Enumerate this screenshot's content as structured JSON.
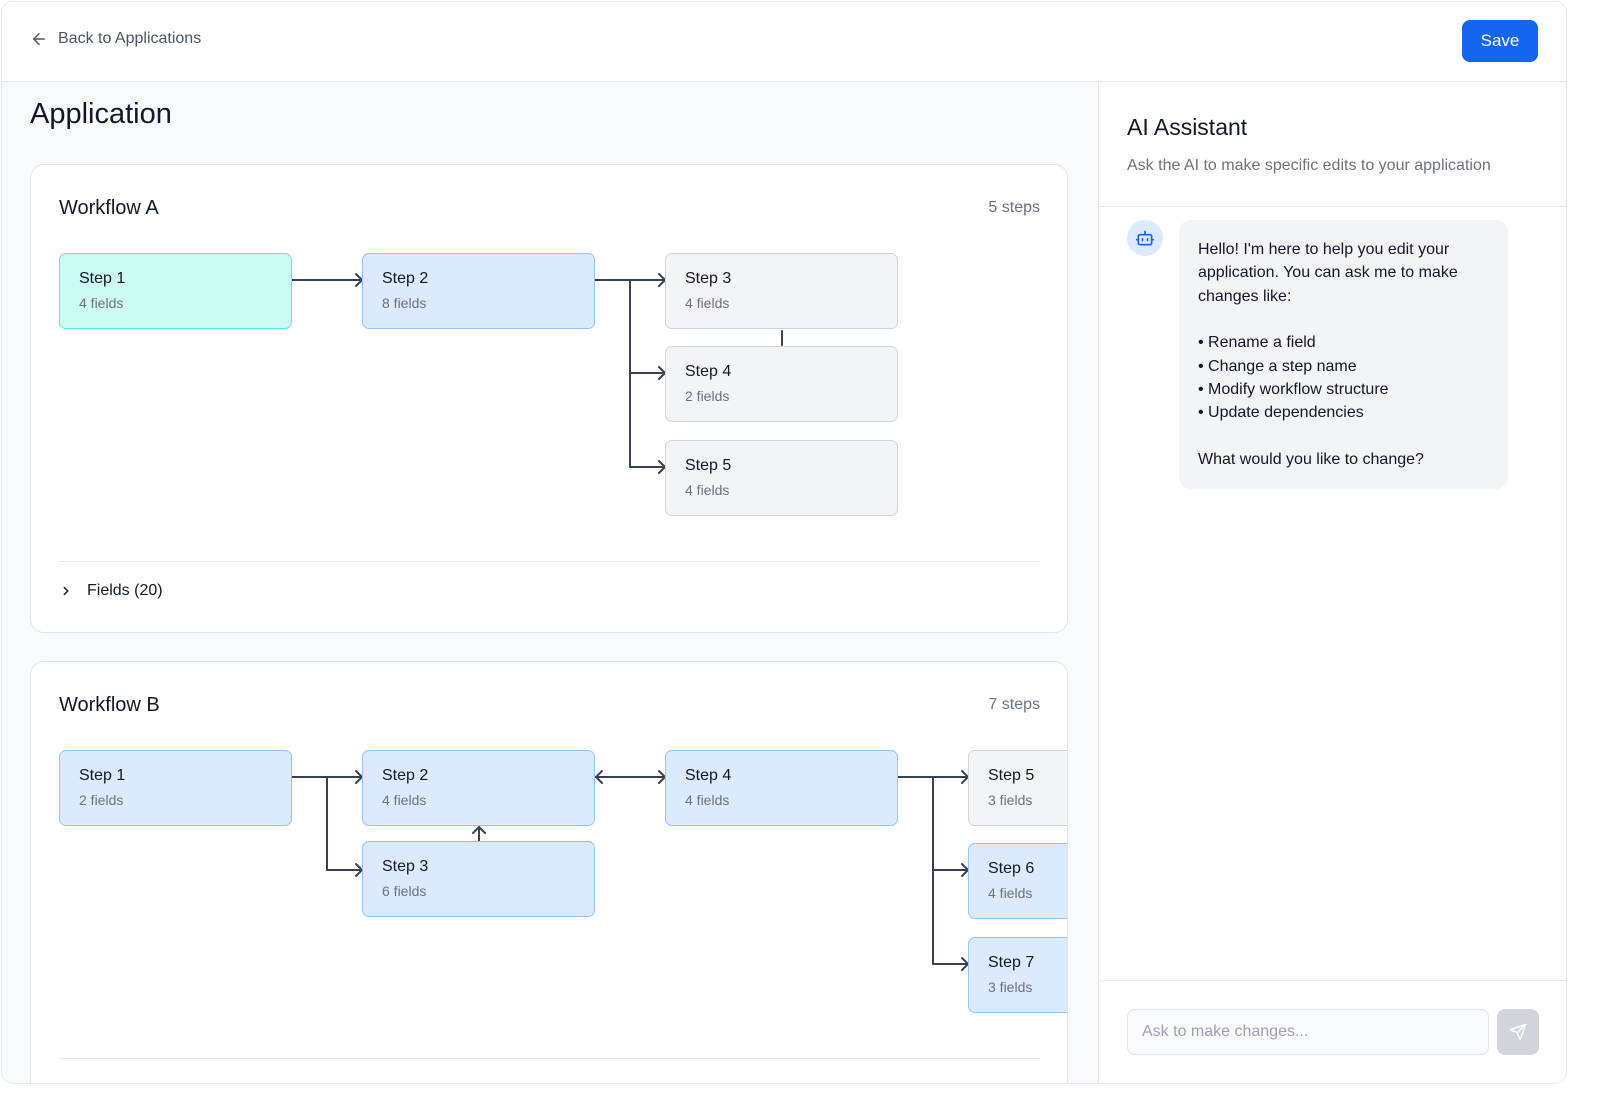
{
  "header": {
    "back_label": "Back to Applications",
    "back_icon": "arrow-left-icon",
    "save_label": "Save",
    "accent": "#1465f0"
  },
  "main": {
    "title": "Application",
    "workflows": [
      {
        "title": "Workflow A",
        "steps_count": "5 steps",
        "nodes": [
          {
            "name": "Step 1",
            "fields": "4 fields",
            "status": "green"
          },
          {
            "name": "Step 2",
            "fields": "8 fields",
            "status": "blue"
          },
          {
            "name": "Step 3",
            "fields": "4 fields",
            "status": "gray"
          },
          {
            "name": "Step 4",
            "fields": "2 fields",
            "status": "gray"
          },
          {
            "name": "Step 5",
            "fields": "4 fields",
            "status": "gray"
          }
        ],
        "fields_toggle": "Fields (20)"
      },
      {
        "title": "Workflow B",
        "steps_count": "7 steps",
        "nodes": [
          {
            "name": "Step 1",
            "fields": "2 fields",
            "status": "blue"
          },
          {
            "name": "Step 2",
            "fields": "4 fields",
            "status": "blue"
          },
          {
            "name": "Step 3",
            "fields": "6 fields",
            "status": "blue"
          },
          {
            "name": "Step 4",
            "fields": "4 fields",
            "status": "blue"
          },
          {
            "name": "Step 5",
            "fields": "3 fields",
            "status": "gray"
          },
          {
            "name": "Step 6",
            "fields": "4 fields",
            "status": "blue"
          },
          {
            "name": "Step 7",
            "fields": "3 fields",
            "status": "blue"
          }
        ]
      }
    ],
    "status_colors": {
      "green": "#ccfbf1",
      "blue": "#dbeafe",
      "gray": "#f3f4f6"
    }
  },
  "assistant": {
    "title": "AI Assistant",
    "subtitle": "Ask the AI to make specific edits to your application",
    "avatar_icon": "robot-icon",
    "message": {
      "intro": "Hello! I'm here to help you edit your application. You can ask me to make changes like:",
      "bullets": [
        "Rename a field",
        "Change a step name",
        "Modify workflow structure",
        "Update dependencies"
      ],
      "outro": "What would you like to change?"
    },
    "input_placeholder": "Ask to make changes...",
    "send_icon": "send-icon"
  }
}
